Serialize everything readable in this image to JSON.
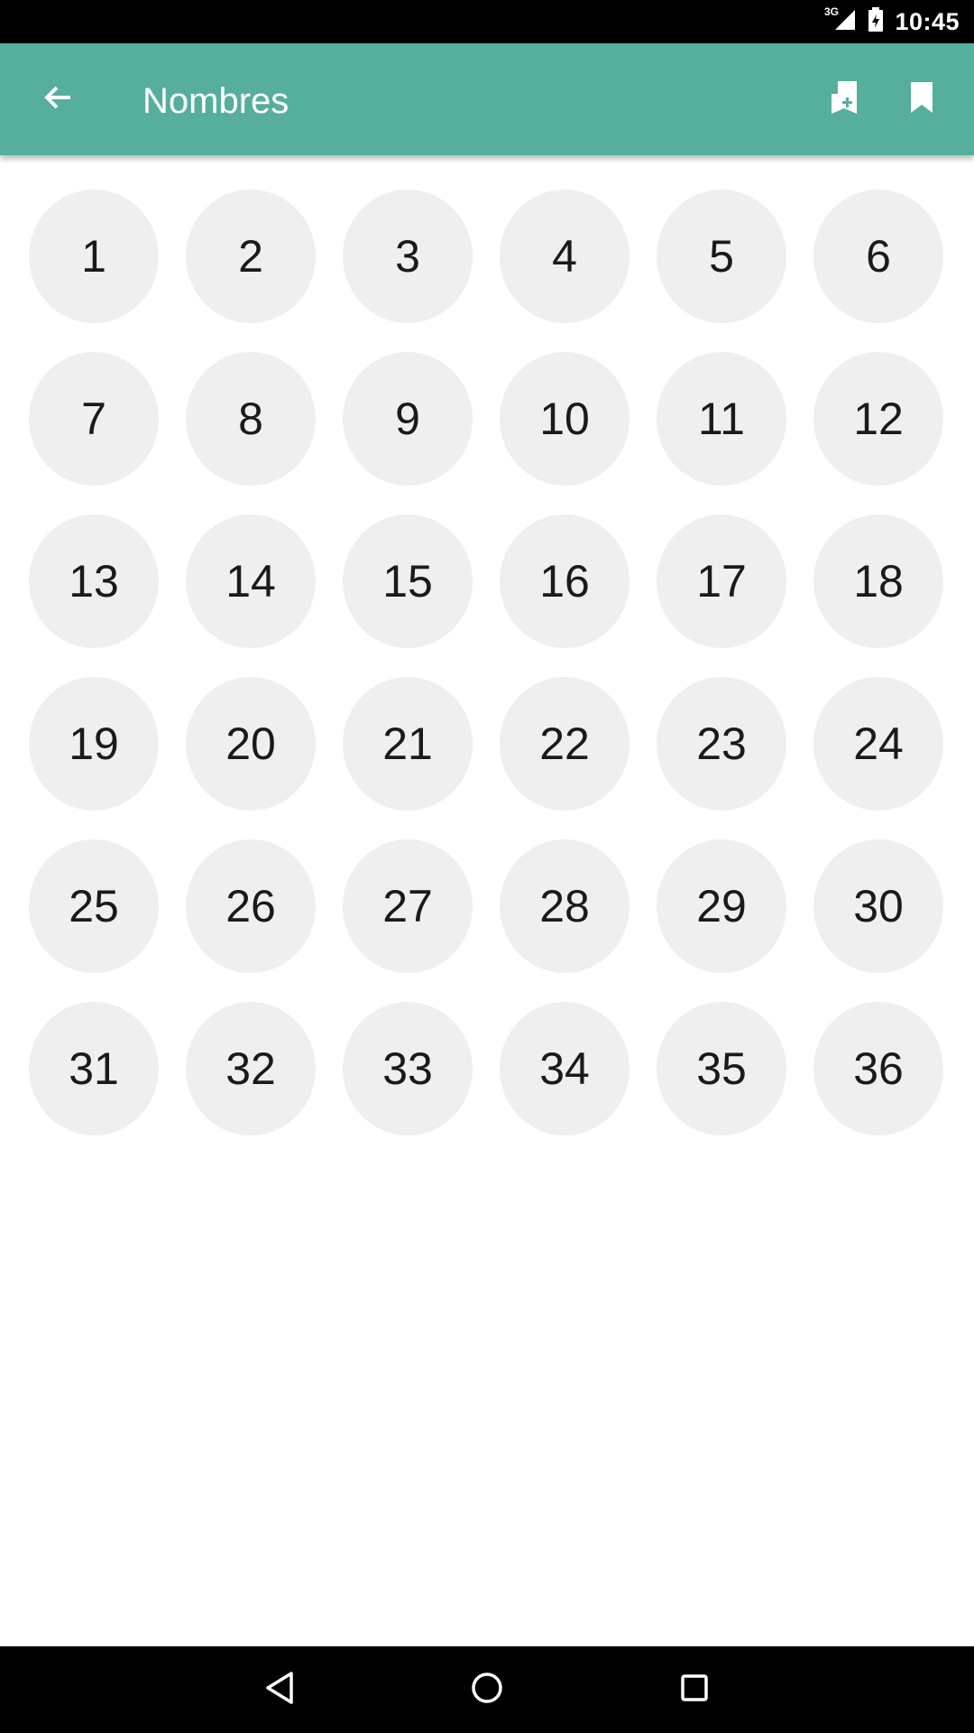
{
  "status_bar": {
    "network_type": "3G",
    "time": "10:45",
    "icons": [
      "signal-icon",
      "battery-icon"
    ]
  },
  "app_bar": {
    "title": "Nombres",
    "back_icon": "arrow-back-icon",
    "actions": [
      "add-bookmark-icon",
      "bookmark-icon"
    ],
    "background_color": "#56ae9c"
  },
  "numbers": [
    "1",
    "2",
    "3",
    "4",
    "5",
    "6",
    "7",
    "8",
    "9",
    "10",
    "11",
    "12",
    "13",
    "14",
    "15",
    "16",
    "17",
    "18",
    "19",
    "20",
    "21",
    "22",
    "23",
    "24",
    "25",
    "26",
    "27",
    "28",
    "29",
    "30",
    "31",
    "32",
    "33",
    "34",
    "35",
    "36"
  ],
  "nav_bar": {
    "icons": [
      "back-triangle-icon",
      "home-circle-icon",
      "recents-square-icon"
    ]
  }
}
